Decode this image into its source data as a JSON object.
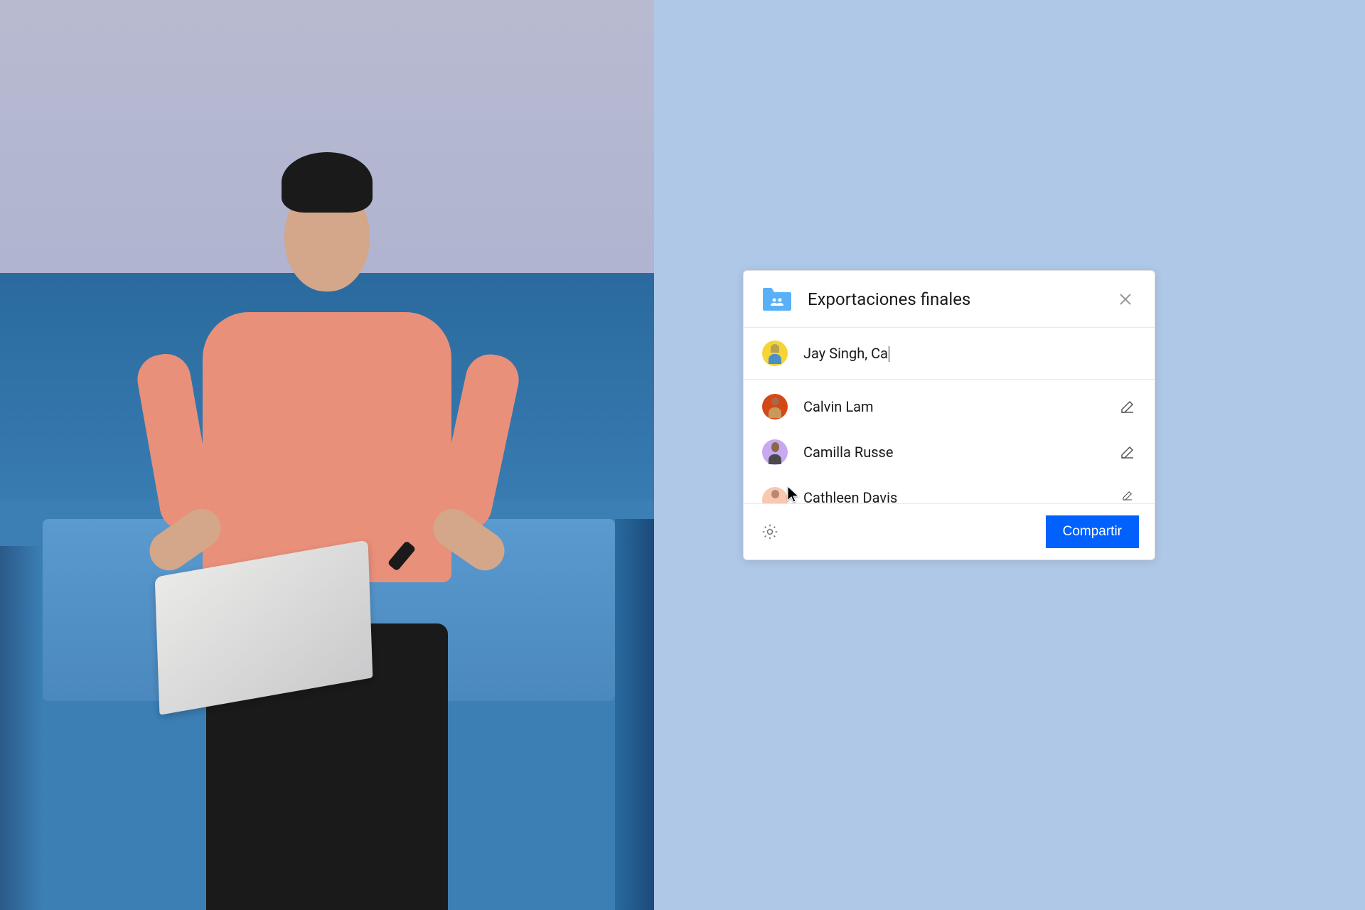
{
  "dialog": {
    "title": "Exportaciones finales",
    "input_value": "Jay Singh, Ca",
    "share_button": "Compartir",
    "suggestions": [
      {
        "name": "Calvin Lam",
        "avatar_class": "av-orange"
      },
      {
        "name": "Camilla Russe",
        "avatar_class": "av-purple"
      },
      {
        "name": "Cathleen Davis",
        "avatar_class": "av-peach"
      }
    ]
  },
  "colors": {
    "primary": "#0061fe",
    "folder": "#5ab0f7"
  }
}
